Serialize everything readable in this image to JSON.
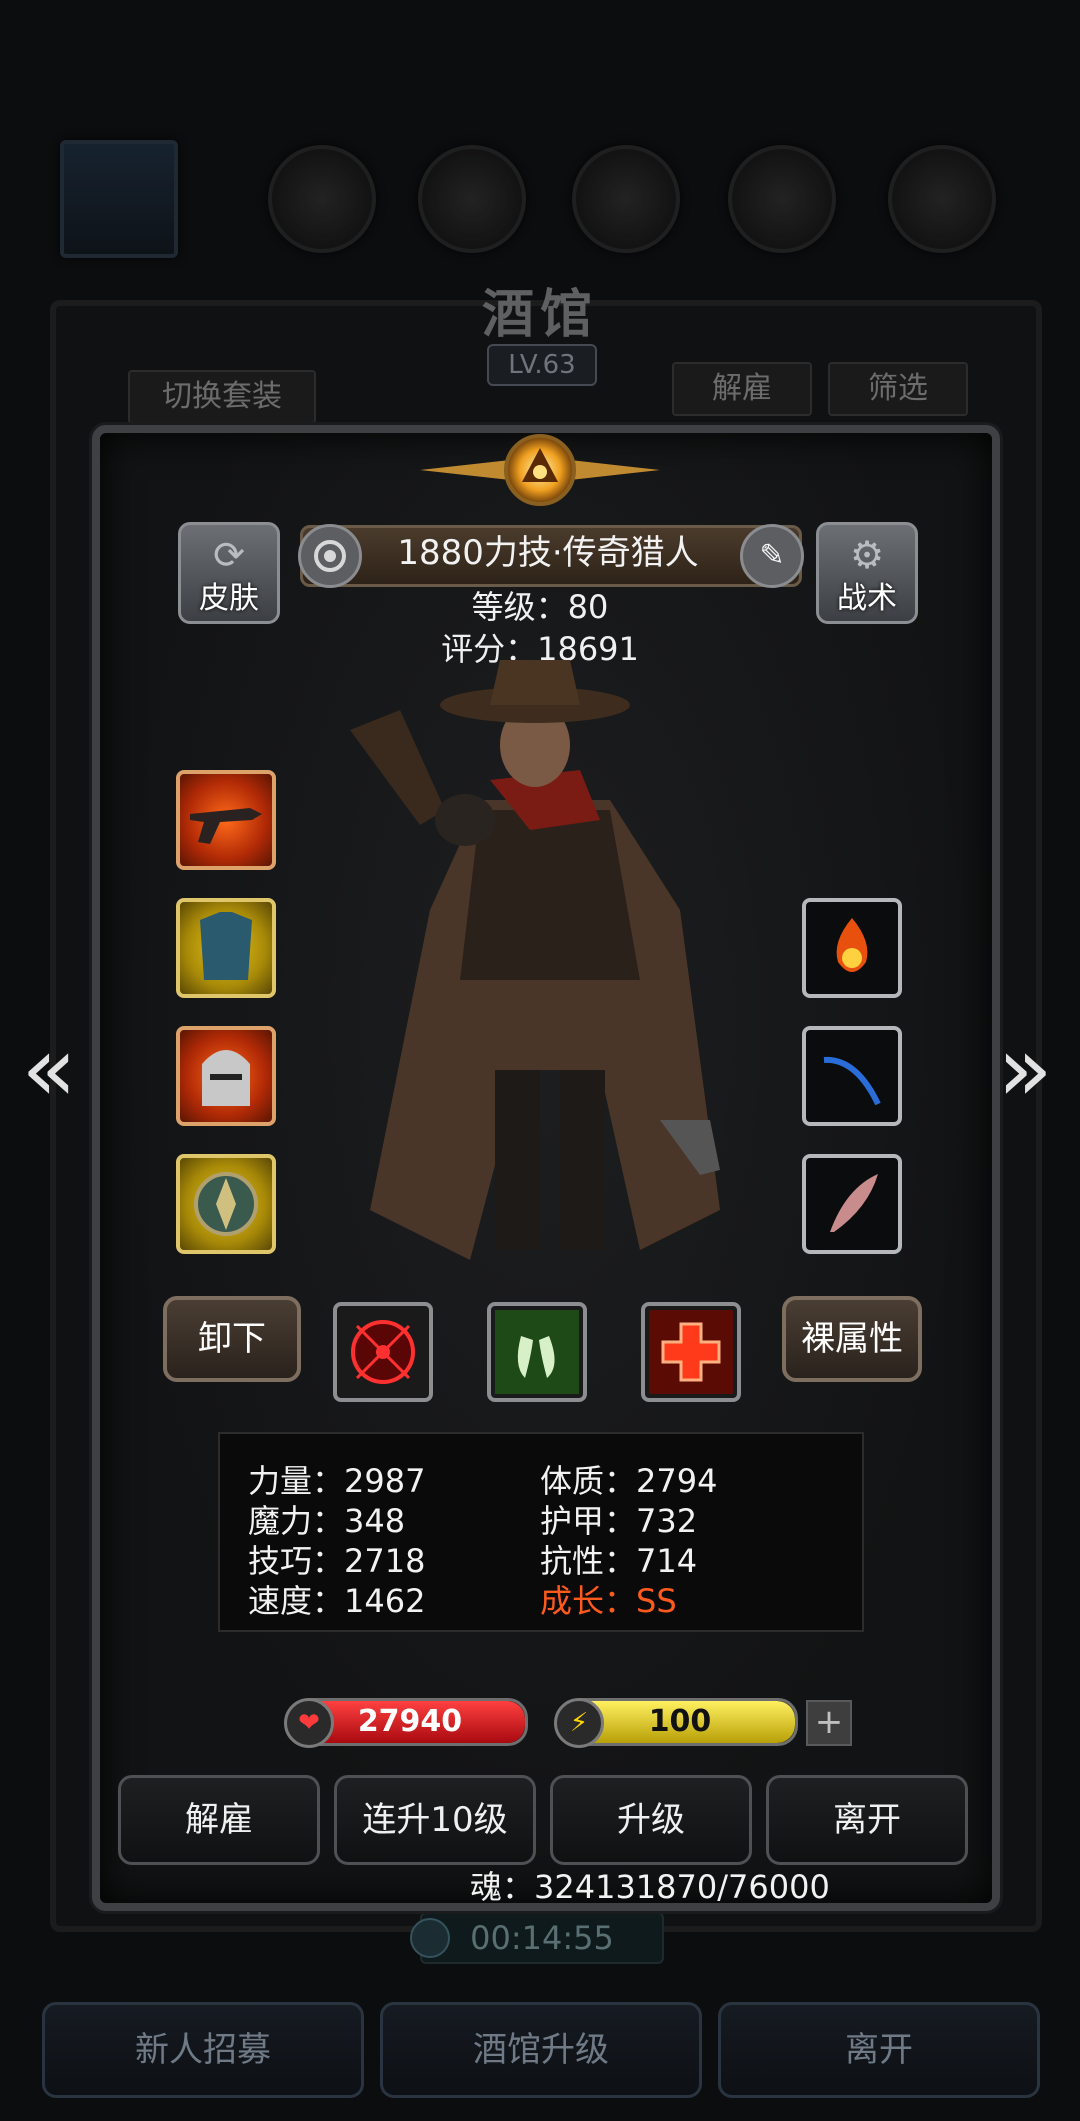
{
  "background": {
    "title": "酒馆",
    "level": "LV.63",
    "switch_set_label": "切换套装",
    "dismiss_label": "解雇",
    "filter_label": "筛选",
    "timer": "00:14:55",
    "bottom_buttons": [
      "新人招募",
      "酒馆升级",
      "离开"
    ]
  },
  "hero": {
    "name": "1880力技·传奇猎人",
    "level_line": "等级：80",
    "score_line": "评分：18691",
    "skin_label": "皮肤",
    "tactics_label": "战术"
  },
  "equipment": {
    "left_slots": [
      "flintlock-pistol-icon",
      "armor-vest-icon",
      "knight-helmet-icon",
      "shield-amulet-icon"
    ],
    "right_slots": [
      "fire-essence-icon",
      "blue-whip-icon",
      "feather-icon"
    ]
  },
  "skills_row": {
    "unequip_label": "卸下",
    "bare_attributes_label": "裸属性",
    "skills": [
      "crosshair-skill-icon",
      "green-claw-skill-icon",
      "red-cross-skill-icon"
    ]
  },
  "stats": {
    "strength": "力量：2987",
    "magic": "魔力：348",
    "skill": "技巧：2718",
    "speed": "速度：1462",
    "constitution": "体质：2794",
    "armor": "护甲：732",
    "resistance": "抗性：714",
    "growth": "成长：SS"
  },
  "vitals": {
    "hp": "27940",
    "hp_fill": 1.0,
    "energy": "100",
    "energy_fill": 1.0
  },
  "actions": [
    "解雇",
    "连升10级",
    "升级",
    "离开"
  ],
  "soul": "魂：324131870/76000",
  "colors": {
    "hp": "#d8141c",
    "energy": "#e6d81a",
    "growth": "#ff5a1e"
  }
}
